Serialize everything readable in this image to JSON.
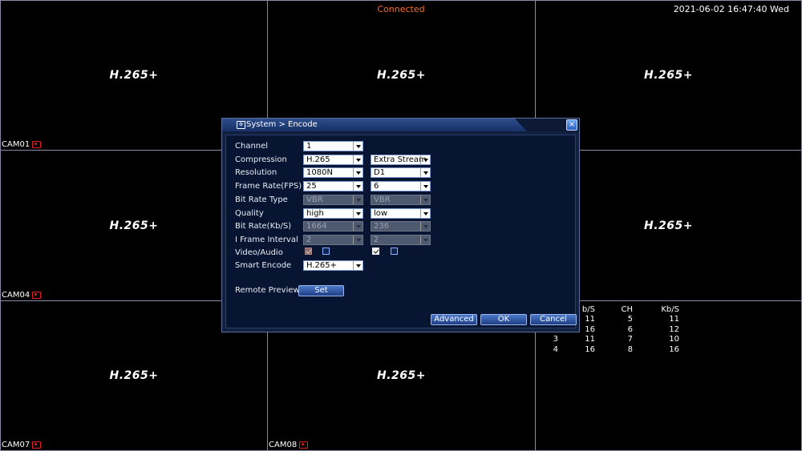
{
  "status": "Connected",
  "clock": "2021-06-02 16:47:40 Wed",
  "grid": {
    "cells": [
      {
        "codec": "H.265+",
        "cam": "CAM01"
      },
      {
        "codec": "H.265+",
        "cam": ""
      },
      {
        "codec": "H.265+",
        "cam": ""
      },
      {
        "codec": "H.265+",
        "cam": "CAM04"
      },
      {
        "codec": "",
        "cam": ""
      },
      {
        "codec": "H.265+",
        "cam": ""
      },
      {
        "codec": "H.265+",
        "cam": "CAM07"
      },
      {
        "codec": "H.265+",
        "cam": "CAM08"
      },
      {
        "codec": "",
        "cam": ""
      }
    ]
  },
  "stats": {
    "headers": [
      "",
      "b/S",
      "CH",
      "Kb/S"
    ],
    "rows": [
      [
        "",
        "11",
        "5",
        "11"
      ],
      [
        "",
        "16",
        "6",
        "12"
      ],
      [
        "3",
        "11",
        "7",
        "10"
      ],
      [
        "4",
        "16",
        "8",
        "16"
      ]
    ]
  },
  "dialog": {
    "title": "System > Encode",
    "close": "×",
    "labels": {
      "channel": "Channel",
      "compression": "Compression",
      "resolution": "Resolution",
      "frame_rate": "Frame Rate(FPS)",
      "bit_rate_type": "Bit Rate Type",
      "quality": "Quality",
      "bit_rate": "Bit Rate(Kb/S)",
      "i_frame": "I Frame Interval",
      "video_audio": "Video/Audio",
      "smart_encode": "Smart Encode",
      "remote_preview": "Remote Preview"
    },
    "main": {
      "channel": "1",
      "compression": "H.265",
      "resolution": "1080N",
      "frame_rate": "25",
      "bit_rate_type": "VBR",
      "quality": "high",
      "bit_rate": "1664",
      "i_frame": "2",
      "video_checked": true,
      "audio_checked": false,
      "smart_encode": "H.265+"
    },
    "extra": {
      "stream": "Extra Stream",
      "resolution": "D1",
      "frame_rate": "6",
      "bit_rate_type": "VBR",
      "quality": "low",
      "bit_rate": "236",
      "i_frame": "2",
      "video_checked": true,
      "audio_checked": false
    },
    "buttons": {
      "set": "Set",
      "advanced": "Advanced",
      "ok": "OK",
      "cancel": "Cancel"
    }
  }
}
